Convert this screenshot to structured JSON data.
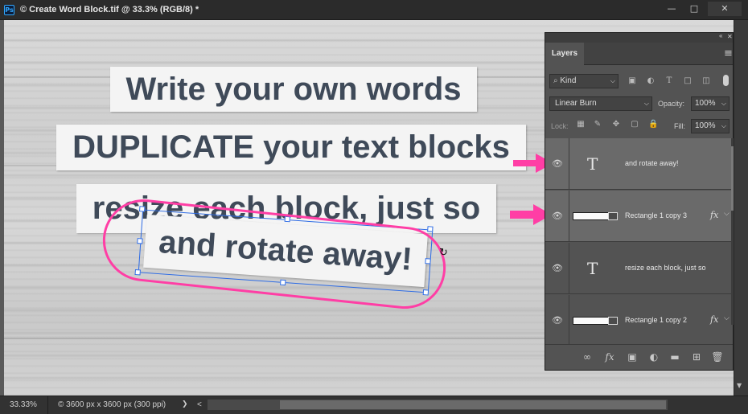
{
  "titlebar": {
    "app_icon": "Ps",
    "document_title": "© Create Word Block.tif @ 33.3% (RGB/8) *",
    "minimize": "—",
    "maximize": "□",
    "close": "✕"
  },
  "canvas": {
    "blocks": [
      "Write your own words",
      "DUPLICATE your text blocks",
      "resize each block, just so",
      "and rotate away!"
    ],
    "highlight_color": "#ff3ea5",
    "selection_color": "#2d6be4"
  },
  "status": {
    "zoom": "33.33%",
    "doc_info": "© 3600 px x 3600 px (300 ppi)",
    "arrow": "❯",
    "scroll_left": "<"
  },
  "layers_panel": {
    "collapse_icon": "«",
    "close_icon": "✕",
    "tab_label": "Layers",
    "menu_icon": "≡",
    "filter_kind": "Kind",
    "blend_mode": "Linear Burn",
    "opacity_label": "Opacity:",
    "opacity_value": "100%",
    "lock_label": "Lock:",
    "fill_label": "Fill:",
    "fill_value": "100%",
    "layers": [
      {
        "name": "and rotate away!",
        "type": "text",
        "fx": false,
        "selected": true
      },
      {
        "name": "Rectangle 1 copy 3",
        "type": "shape",
        "fx": true,
        "selected": true
      },
      {
        "name": "resize each block, just so",
        "type": "text",
        "fx": false,
        "selected": false
      },
      {
        "name": "Rectangle 1 copy 2",
        "type": "shape",
        "fx": true,
        "selected": false
      }
    ],
    "fx_symbol": "fx",
    "text_symbol": "T"
  }
}
